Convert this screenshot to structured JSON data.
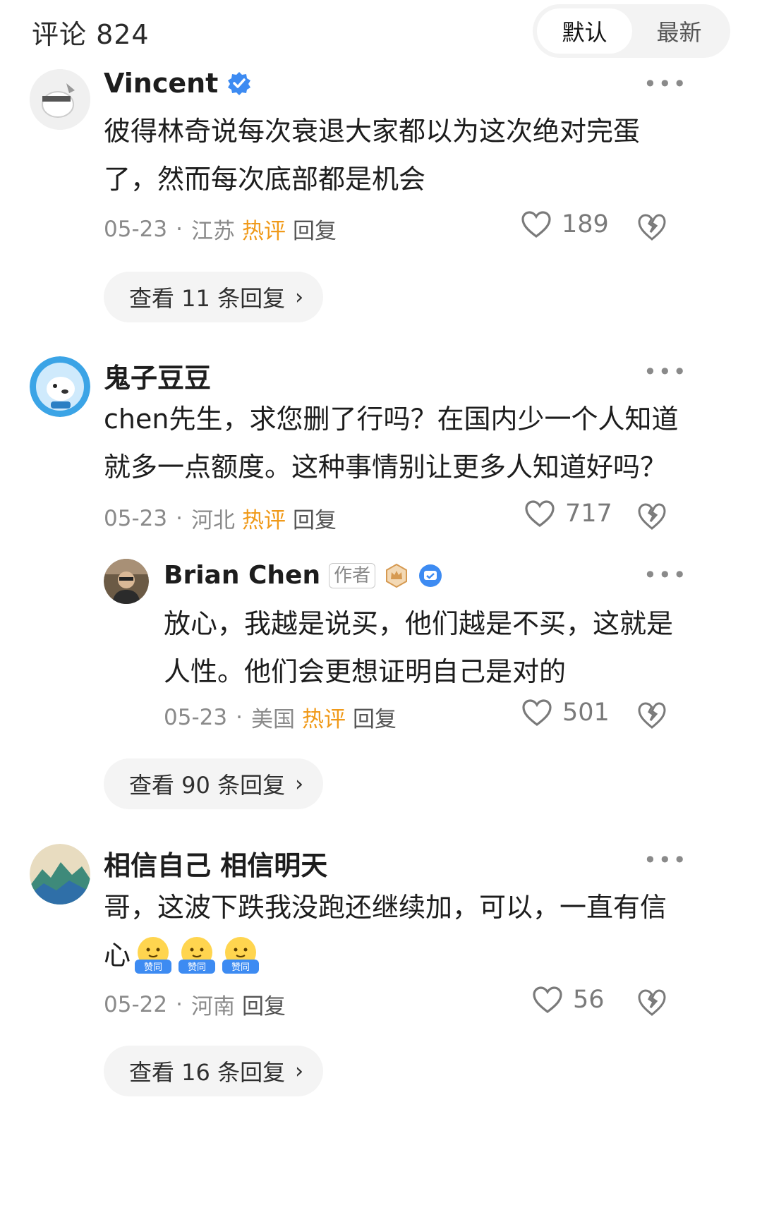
{
  "header": {
    "title": "评论 824",
    "sort_default": "默认",
    "sort_latest": "最新"
  },
  "comments": [
    {
      "name": "Vincent",
      "text_line1": "彼得林奇说每次衰退大家都以为这次绝对完蛋",
      "text_line2": "了，然而每次底部都是机会",
      "date": "05-23",
      "location": "江苏",
      "hot_label": "热评",
      "reply_label": "回复",
      "likes": "189",
      "view_replies": "查看 11 条回复"
    },
    {
      "name": "鬼子豆豆",
      "text_line1": "chen先生，求您删了行吗？在国内少一个人知道",
      "text_line2": "就多一点额度。这种事情别让更多人知道好吗？",
      "date": "05-23",
      "location": "河北",
      "hot_label": "热评",
      "reply_label": "回复",
      "likes": "717",
      "reply": {
        "name": "Brian Chen",
        "author_tag": "作者",
        "text_line1": "放心，我越是说买，他们越是不买，这就是",
        "text_line2": "人性。他们会更想证明自己是对的",
        "date": "05-23",
        "location": "美国",
        "hot_label": "热评",
        "reply_label": "回复",
        "likes": "501"
      },
      "view_replies": "查看 90 条回复"
    },
    {
      "name": "相信自己 相信明天",
      "text_line1": "哥，这波下跌我没跑还继续加，可以，一直有信",
      "text_line2": "心",
      "emoji_label": "赞同",
      "date": "05-22",
      "location": "河南",
      "reply_label": "回复",
      "likes": "56",
      "view_replies": "查看 16 条回复"
    }
  ],
  "more_icon": "•••",
  "dot_separator": "·",
  "chevron": "›",
  "colors": {
    "hot": "#f09a1a",
    "verified": "#3d8bf2",
    "meta": "#8a8a8a"
  }
}
